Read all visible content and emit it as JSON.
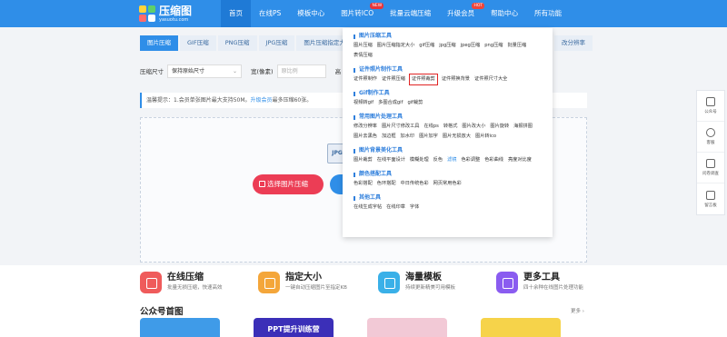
{
  "brand": {
    "name": "压缩图",
    "domain": "yasuotu.com"
  },
  "nav": {
    "items": [
      {
        "label": "首页",
        "active": true
      },
      {
        "label": "在线PS"
      },
      {
        "label": "模板中心"
      },
      {
        "label": "图片转ICO",
        "badge": "NEW"
      },
      {
        "label": "批量云端压缩"
      },
      {
        "label": "升级会员",
        "badge": "HOT"
      },
      {
        "label": "帮助中心"
      },
      {
        "label": "所有功能"
      }
    ]
  },
  "tabs": [
    "图片压缩",
    "GIF压缩",
    "PNG压缩",
    "JPG压缩",
    "图片压缩指定大小"
  ],
  "tab_right": "改分辨率",
  "filters": {
    "size_label": "压缩尺寸",
    "size_value": "保持原始尺寸",
    "width_label": "宽(像素)",
    "width_placeholder": "原比例",
    "height_label": "高"
  },
  "notice": {
    "text": "温馨提示：1.会员单张图片最大支持50M。",
    "highlight": "升级会员",
    "tail": "最多压缩60张。"
  },
  "upload": {
    "button": "选择图片压缩",
    "file_icon": "JPG"
  },
  "dropdown": {
    "sections": [
      {
        "title": "图片压缩工具",
        "links": [
          "图片压缩",
          "图片压缩指定大小",
          "gif压缩",
          "jpg压缩",
          "jpeg压缩",
          "png压缩",
          "批量压缩",
          "表情压缩"
        ]
      },
      {
        "title": "证件照片制作工具",
        "links": [
          "证件照制作",
          "证件照压缩",
          "证件照裁剪",
          "证件照换背景",
          "证件照尺寸大全"
        ],
        "boxed_index": 2
      },
      {
        "title": "Gif制作工具",
        "links": [
          "视频转gif",
          "多图合成gif",
          "gif裁剪"
        ]
      },
      {
        "title": "常用图片处理工具",
        "links": [
          "修改分辨率",
          "图片尺寸修改工具",
          "在线ps",
          "转格式",
          "图片改大小",
          "图片旋转",
          "海报拼图",
          "图片去黑色",
          "加边框",
          "加水印",
          "图片加字",
          "图片无损放大",
          "图片转ico"
        ]
      },
      {
        "title": "图片背景美化工具",
        "links": [
          "图片裁剪",
          "在线平面设计",
          "模糊处理",
          "反色",
          "滤镜",
          "色彩调整",
          "色彩曲线",
          "亮度对比度"
        ],
        "blue_index": 4
      },
      {
        "title": "颜色搭配工具",
        "links": [
          "色彩搭配",
          "色环搭配",
          "中日传统色彩",
          "网页常用色彩"
        ]
      },
      {
        "title": "其他工具",
        "links": [
          "在线生成字帖",
          "在线印章",
          "字体"
        ]
      }
    ]
  },
  "sidebar": [
    "公众号",
    "客服",
    "问卷调查",
    "留言板"
  ],
  "features": [
    {
      "title": "在线压缩",
      "sub": "批量无损压缩，快速高效",
      "color": "#ef5b5b"
    },
    {
      "title": "指定大小",
      "sub": "一键自动压缩图片至指定KB",
      "color": "#f4a63a"
    },
    {
      "title": "海量模板",
      "sub": "持续更新精美可用模板",
      "color": "#3ab0e8"
    },
    {
      "title": "更多工具",
      "sub": "四十余种在线图片处理功能",
      "color": "#8a5cf0"
    }
  ],
  "gzh": {
    "title": "公众号首图",
    "more": "更多 ›"
  },
  "cards": [
    {
      "text": "",
      "color": "#3f9be8"
    },
    {
      "text": "PPT提升训练营",
      "color": "#3b2fb8"
    },
    {
      "text": "",
      "color": "#f2c9d6"
    },
    {
      "text": "",
      "color": "#f6d34a"
    }
  ]
}
